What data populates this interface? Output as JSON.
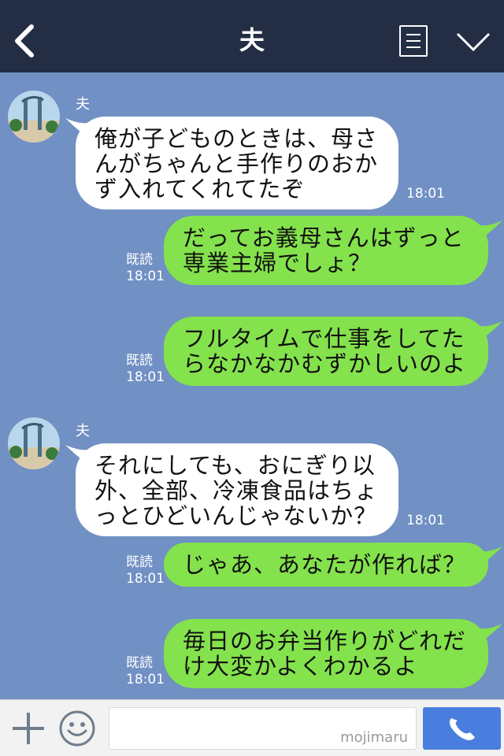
{
  "header": {
    "title": "夫"
  },
  "messages": [
    {
      "side": "left",
      "sender": "夫",
      "lines": [
        "俺が子どものときは、母さ",
        "んがちゃんと手作りのおか",
        "ず入れてくれてたぞ"
      ],
      "time": "18:01"
    },
    {
      "side": "right",
      "read": "既読",
      "time": "18:01",
      "lines": [
        "だってお義母さんはずっと",
        "専業主婦でしょ？"
      ]
    },
    {
      "side": "right",
      "read": "既読",
      "time": "18:01",
      "lines": [
        "フルタイムで仕事をしてた",
        "らなかなかむずかしいのよ"
      ]
    },
    {
      "side": "left",
      "sender": "夫",
      "lines": [
        "それにしても、おにぎり以",
        "外、全部、冷凍食品はちょ",
        "っとひどいんじゃないか？"
      ],
      "time": "18:01"
    },
    {
      "side": "right",
      "read": "既読",
      "time": "18:01",
      "lines": [
        "じゃあ、あなたが作れば？"
      ]
    },
    {
      "side": "right",
      "read": "既読",
      "time": "18:01",
      "lines": [
        "毎日のお弁当作りがどれだ",
        "け大変かよくわかるよ"
      ]
    }
  ],
  "footer": {
    "watermark": "mojimaru"
  },
  "colors": {
    "header": "#232e45",
    "background": "#7190c4",
    "green_bubble": "#84e24c",
    "send": "#4a7ede"
  }
}
